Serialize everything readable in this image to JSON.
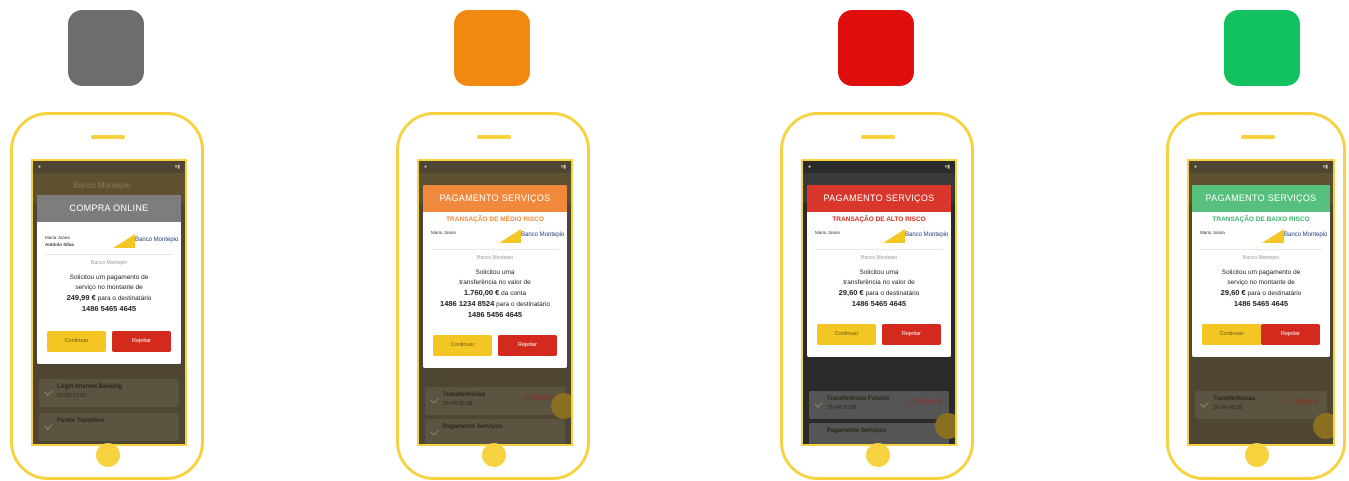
{
  "panels": [
    {
      "swatch_color": "#6d6d6d",
      "header_color": "#7d7d7d",
      "header": "COMPRA ONLINE",
      "risk_label": "",
      "risk_color": "",
      "name_line1": "Maria Joana",
      "name_line2": "António Silva",
      "bank_logo": "Banco Montepio",
      "bank_small": "Banco Montepio",
      "msg_line1": "Solicitou um pagamento de",
      "msg_line2": "serviço no montante de",
      "amount": "249,99 €",
      "msg_line3": "para o destinatário",
      "account": "",
      "msg_line4": "",
      "dest_account": "1486 5465 4645",
      "btn_continue": "Continuar",
      "btn_reject": "Rejeitar",
      "bg_row1_title": "Login Internet Banking",
      "bg_row1_date": "02-03  17:02",
      "bg_row1_amount": "",
      "bg_row2_title": "Fundo Transfere",
      "bg_row2_amount": "",
      "appbar_title": "Banco Montepio"
    },
    {
      "swatch_color": "#f28a12",
      "header_color": "#f0893b",
      "header": "PAGAMENTO SERVIÇOS",
      "risk_label": "TRANSAÇÃO DE MÉDIO RISCO",
      "risk_color": "#f0893b",
      "name_line1": "Mario Joana",
      "name_line2": "",
      "bank_logo": "Banco Montepio",
      "bank_small": "Banco Montepio",
      "msg_line1": "Solicitou uma",
      "msg_line2": "transferência no valor de",
      "amount": "1.760,00 €",
      "msg_line3": "da conta",
      "account": "1486 1234 8524",
      "msg_line4": "para o destinatário",
      "dest_account": "1486 5456 4645",
      "btn_continue": "Continuar",
      "btn_reject": "Rejeitar",
      "bg_row1_title": "Transferências",
      "bg_row1_date": "26-04  00:38",
      "bg_row1_amount": "1.720,54 €",
      "bg_row2_title": "Pagamento Serviços",
      "bg_row2_amount": "",
      "appbar_title": ""
    },
    {
      "swatch_color": "#e00d0d",
      "header_color": "#d9372b",
      "header": "PAGAMENTO SERVIÇOS",
      "risk_label": "TRANSAÇÃO DE ALTO RISCO",
      "risk_color": "#d42a1e",
      "name_line1": "Mario Joana",
      "name_line2": "",
      "bank_logo": "Banco Montepio",
      "bank_small": "Banco Montepio",
      "msg_line1": "Solicitou uma",
      "msg_line2": "transferência no valor de",
      "amount": "29,60 €",
      "msg_line3": "para o destinatário",
      "account": "",
      "msg_line4": "",
      "dest_account": "1486 5465 4645",
      "btn_continue": "Continuar",
      "btn_reject": "Rejeitar",
      "bg_row1_title": "Transferência Fundos",
      "bg_row1_date": "26-04  00:38",
      "bg_row1_amount": "1.720,54 €",
      "bg_row2_title": "Pagamento Serviços",
      "bg_row2_amount": "",
      "appbar_title": ""
    },
    {
      "swatch_color": "#12c25e",
      "header_color": "#57c07e",
      "header": "PAGAMENTO SERVIÇOS",
      "risk_label": "TRANSAÇÃO DE BAIXO RISCO",
      "risk_color": "#3cb56a",
      "name_line1": "Mario Joana",
      "name_line2": "",
      "bank_logo": "Banco Montepio",
      "bank_small": "Banco Montepio",
      "msg_line1": "Solicitou um pagamento de",
      "msg_line2": "serviço no montante de",
      "amount": "29,60 €",
      "msg_line3": "para o destinatário",
      "account": "",
      "msg_line4": "",
      "dest_account": "1486 5465 4645",
      "btn_continue": "Continuar",
      "btn_reject": "Rejeitar",
      "bg_row1_title": "Transferências",
      "bg_row1_date": "26-04  00:38",
      "bg_row1_amount": "1.720,54 €",
      "bg_row2_title": "",
      "bg_row2_amount": "",
      "appbar_title": ""
    }
  ]
}
